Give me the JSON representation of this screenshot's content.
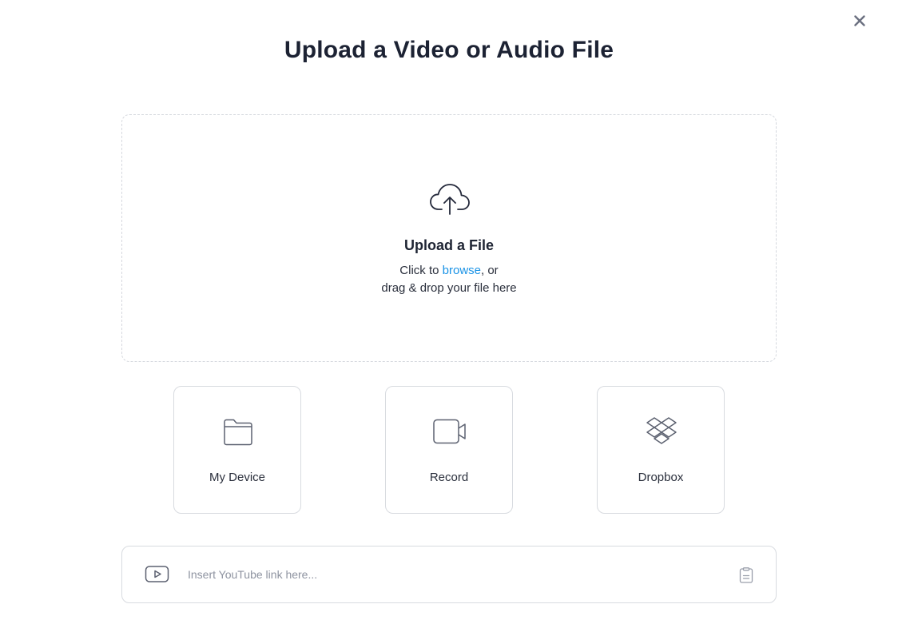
{
  "dialog": {
    "title": "Upload a Video or Audio File",
    "close_icon": "close-icon"
  },
  "dropzone": {
    "icon": "cloud-upload-icon",
    "title": "Upload a File",
    "line1_prefix": "Click to ",
    "browse_link": "browse",
    "line1_suffix": ", or",
    "line2": "drag & drop your file here"
  },
  "sources": [
    {
      "label": "My Device",
      "icon": "folder-icon"
    },
    {
      "label": "Record",
      "icon": "video-camera-icon"
    },
    {
      "label": "Dropbox",
      "icon": "dropbox-icon"
    }
  ],
  "youtube": {
    "icon": "youtube-play-icon",
    "placeholder": "Insert YouTube link here...",
    "value": "",
    "paste_icon": "clipboard-icon"
  },
  "colors": {
    "link": "#1a93e6",
    "icon_gray": "#5c6170",
    "border": "#d8dbe0"
  }
}
